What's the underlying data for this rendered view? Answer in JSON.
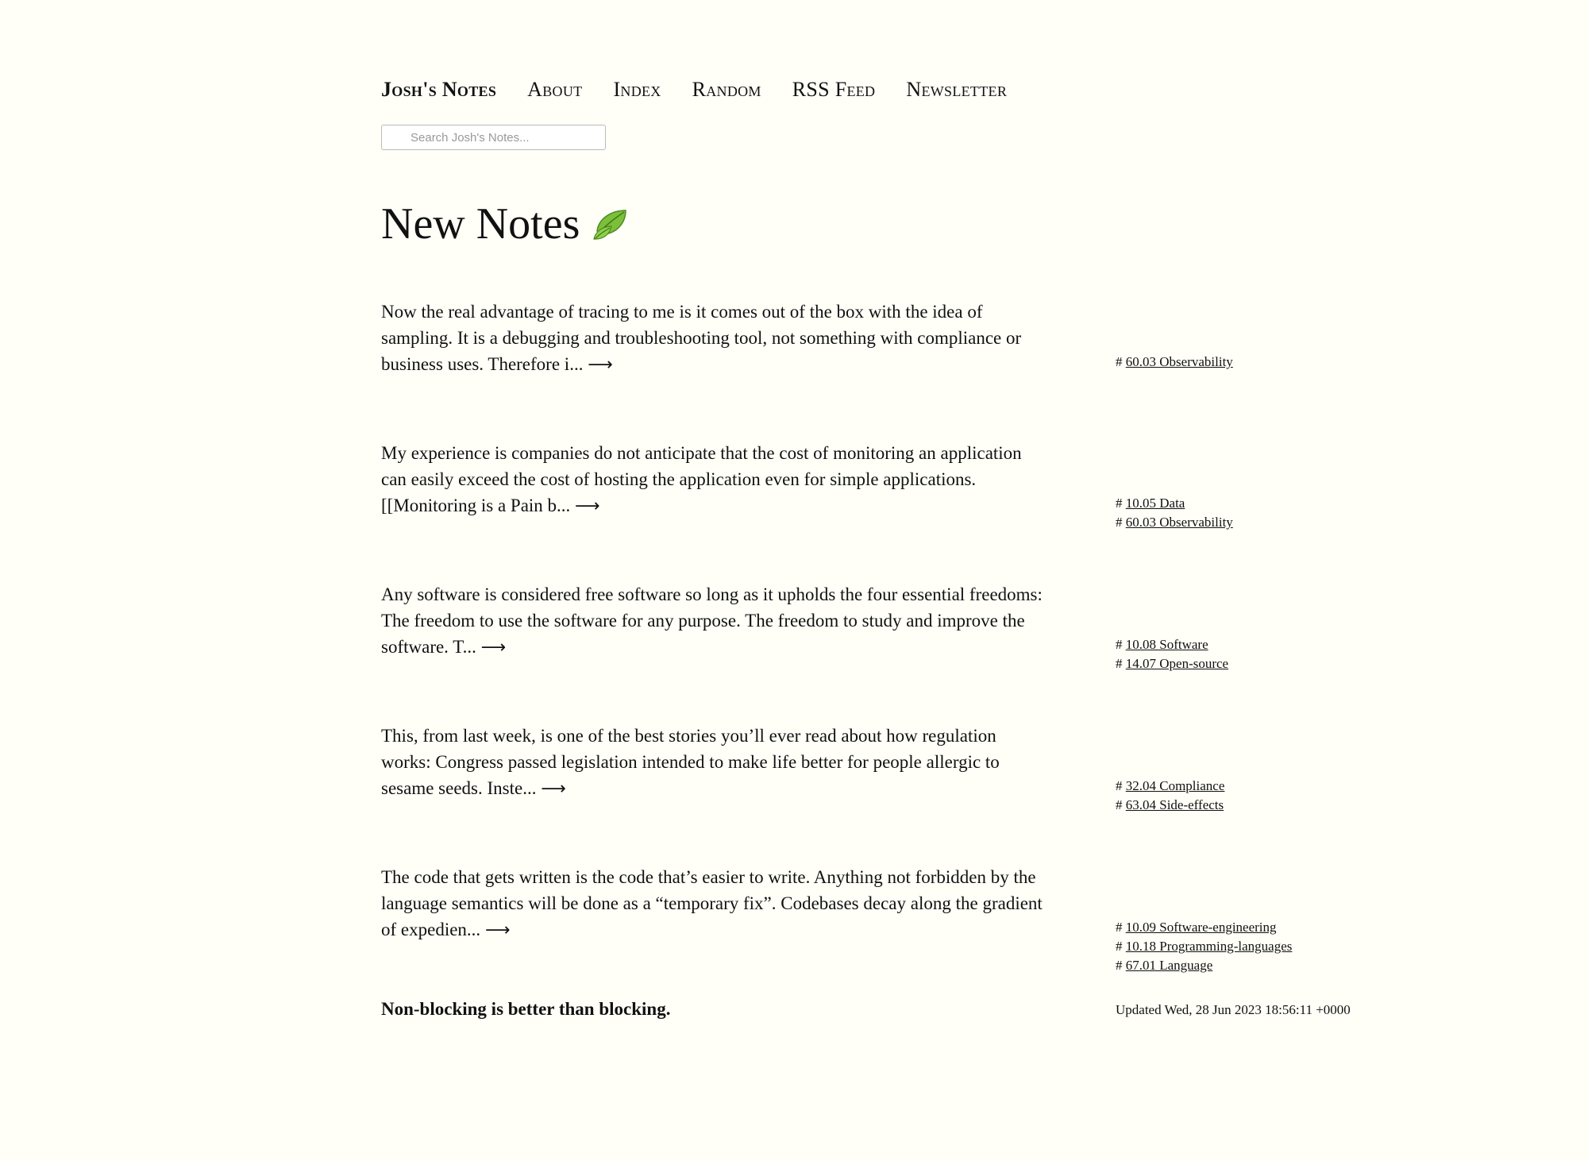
{
  "nav": {
    "brand": "Josh's Notes",
    "items": [
      "About",
      "Index",
      "Random",
      "RSS Feed",
      "Newsletter"
    ]
  },
  "search": {
    "placeholder": "Search Josh's Notes..."
  },
  "page": {
    "title": "New Notes",
    "title_icon": "leaf-icon"
  },
  "notes": [
    {
      "excerpt": "Now the real advantage of tracing to me is it comes out of the box with the idea of sampling. It is a debugging and troubleshooting tool, not something with compliance or business uses. Therefore i...",
      "tags": [
        "60.03 Observability"
      ]
    },
    {
      "excerpt": "My experience is companies do not anticipate that the cost of monitoring an application can easily exceed the cost of hosting the application even for simple applications. [[Monitoring is a Pain b...",
      "tags": [
        "10.05 Data",
        "60.03 Observability"
      ]
    },
    {
      "excerpt": "Any software is considered free software so long as it upholds the four essential freedoms: The freedom to use the software for any purpose. The freedom to study and improve the software. T...",
      "tags": [
        "10.08 Software",
        "14.07 Open-source"
      ]
    },
    {
      "excerpt": "This, from last week, is one of the best stories you’ll ever read about how regulation works: Congress passed legislation intended to make life better for people allergic to sesame seeds. Inste...",
      "tags": [
        "32.04 Compliance",
        "63.04 Side-effects"
      ]
    },
    {
      "excerpt": "The code that gets written is the code that’s easier to write. Anything not forbidden by the language semantics will be done as a “temporary fix”. Codebases decay along the gradient of expedien...",
      "tags": [
        "10.09 Software-engineering",
        "10.18 Programming-languages",
        "67.01 Language"
      ]
    }
  ],
  "arrow_glyph": "⟶",
  "tag_prefix": "#",
  "footer": {
    "heading": "Non-blocking is better than blocking.",
    "updated": "Updated Wed, 28 Jun 2023 18:56:11 +0000"
  }
}
